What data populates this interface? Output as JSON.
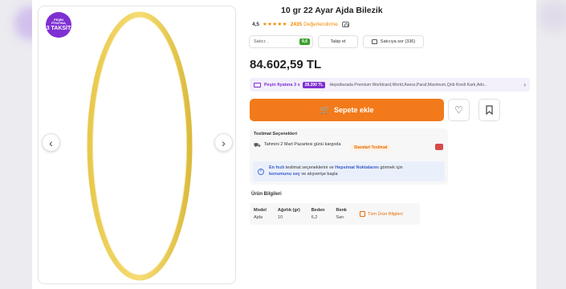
{
  "product": {
    "title": "10 gr 22 Ayar Ajda Bilezik",
    "rating": "4,5",
    "stars": "★★★★★",
    "review_count": "2435",
    "review_label": "Değerlendirme"
  },
  "badge": {
    "line1": "PEŞİN",
    "line2": "FİYATINA",
    "line3": "3 TAKSİT"
  },
  "seller": {
    "label": "Satıcı: .",
    "score": "9,6",
    "follow": "Takip et",
    "ask": "Satıcıya sor (336)"
  },
  "price": "84.602,59 TL",
  "installment": {
    "label": "Peşin fiyatına 3 x",
    "amount": "28.200 TL",
    "banks": "Hepsiburada Premium Worldcard,World,Axess,Paraf,Maximum,Qnb Kredi Kartı,Adv..."
  },
  "cart": {
    "label": "Sepete ekle"
  },
  "delivery": {
    "title": "Teslimat Seçenekleri",
    "estimate": "Tahmini 2 Mart Pazartesi günü kargoda",
    "badge": "Standart Teslimat",
    "info_part1": "En hızlı",
    "info_part2": " teslimat seçeneklerini ve ",
    "info_part3": "Hepsimat Noktalarını",
    "info_part4": " görmek için ",
    "info_part5": "konumunu seç",
    "info_part6": " ve alışverişe başla"
  },
  "features": {
    "title": "Ürün Bilgileri",
    "items": [
      {
        "key": "Model",
        "value": "Ajda"
      },
      {
        "key": "Ağırlık (gr)",
        "value": "10"
      },
      {
        "key": "Beden",
        "value": "6,2"
      },
      {
        "key": "Renk",
        "value": "Sarı"
      }
    ],
    "all_label": "Tüm Ürün Bilgileri"
  },
  "colors": {
    "accent": "#f27a1a",
    "brand_purple": "#7e2fd2",
    "gold": "#e6c84a"
  },
  "icons": {
    "prev": "chevron-left-icon",
    "next": "chevron-right-icon",
    "favorite": "heart-icon",
    "save": "bookmark-icon",
    "cart": "cart-icon",
    "truck": "truck-icon",
    "info": "info-icon",
    "camera": "camera-icon"
  }
}
